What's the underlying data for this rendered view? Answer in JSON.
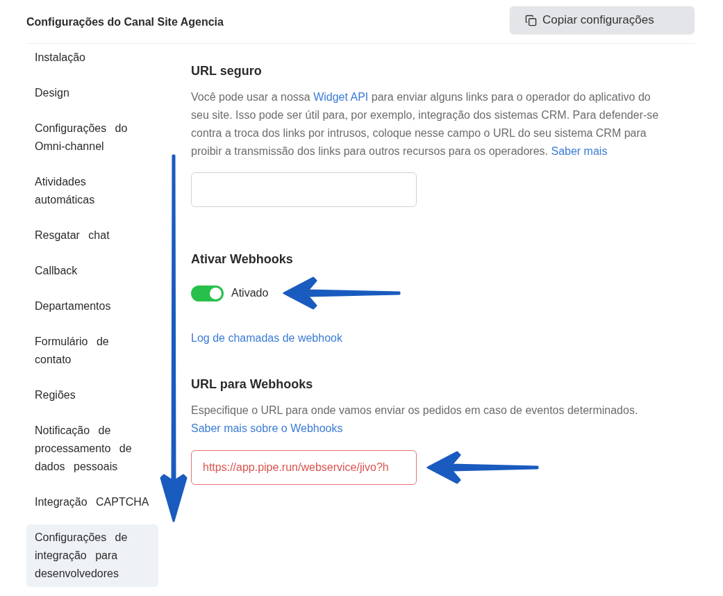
{
  "header": {
    "title": "Configurações do Canal Site Agencia",
    "copy_button": "Copiar configurações"
  },
  "sidebar": {
    "items": [
      {
        "label": "Instalação",
        "selected": false
      },
      {
        "label": "Design",
        "selected": false
      },
      {
        "label": "Configurações do Omni-channel",
        "selected": false
      },
      {
        "label": "Atividades automáticas",
        "selected": false
      },
      {
        "label": "Resgatar chat",
        "selected": false
      },
      {
        "label": "Callback",
        "selected": false
      },
      {
        "label": "Departamentos",
        "selected": false
      },
      {
        "label": "Formulário de contato",
        "selected": false
      },
      {
        "label": "Regiões",
        "selected": false
      },
      {
        "label": "Notificação de processamento de dados pessoais",
        "selected": false
      },
      {
        "label": "Integração CAPTCHA",
        "selected": false
      },
      {
        "label": "Configurações de integração para desenvolvedores",
        "selected": true
      }
    ]
  },
  "sections": [
    {
      "kind": "url",
      "title": "URL seguro",
      "description": [
        {
          "text": "Você pode usar a nossa "
        },
        {
          "link": "Widget API"
        },
        {
          "text": " para enviar alguns links para o operador do aplicativo do seu site. Isso pode ser útil para, por exemplo, integração dos sistemas CRM. Para defender-se contra a troca dos links por intrusos, coloque nesse campo o URL do seu sistema CRM para proibir a transmissão dos links para outros recursos para os operadores. "
        },
        {
          "link": "Saber mais"
        }
      ],
      "invalid": false
    },
    {
      "kind": "toggle",
      "title": "Ativar Webhooks",
      "on": true,
      "state_label": "Ativado",
      "link": "Log de chamadas de webhook"
    },
    {
      "kind": "url",
      "title": "URL para Webhooks",
      "description": [
        {
          "text": "Especifique o URL para onde vamos enviar os pedidos em caso de eventos determinados. "
        },
        {
          "link": "Saber mais sobre o Webhooks"
        }
      ],
      "value": "https://app.pipe.run/webservice/jivo?h",
      "invalid": true
    }
  ]
}
